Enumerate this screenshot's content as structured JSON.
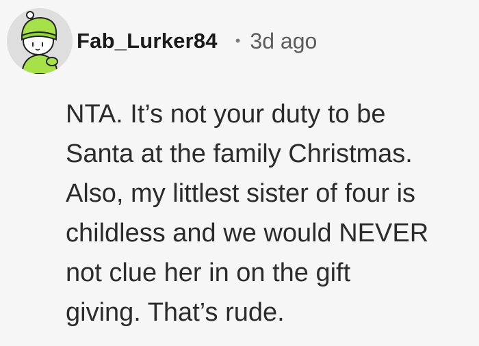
{
  "comment": {
    "username": "Fab_Lurker84",
    "separator": "•",
    "timestamp": "3d ago",
    "avatar": "avatar-icon",
    "text": "NTA. It’s not your duty to be\nSanta at the family Christmas.\nAlso, my littlest sister of four is\nchildless and we would NEVER\nnot clue her in on the gift\ngiving. That’s rude."
  },
  "colors": {
    "background": "#f6f6f6",
    "avatar_bg": "#dedede",
    "beanie": "#a7e14a",
    "username": "#1a1a1b",
    "meta": "#5c5c5c"
  }
}
